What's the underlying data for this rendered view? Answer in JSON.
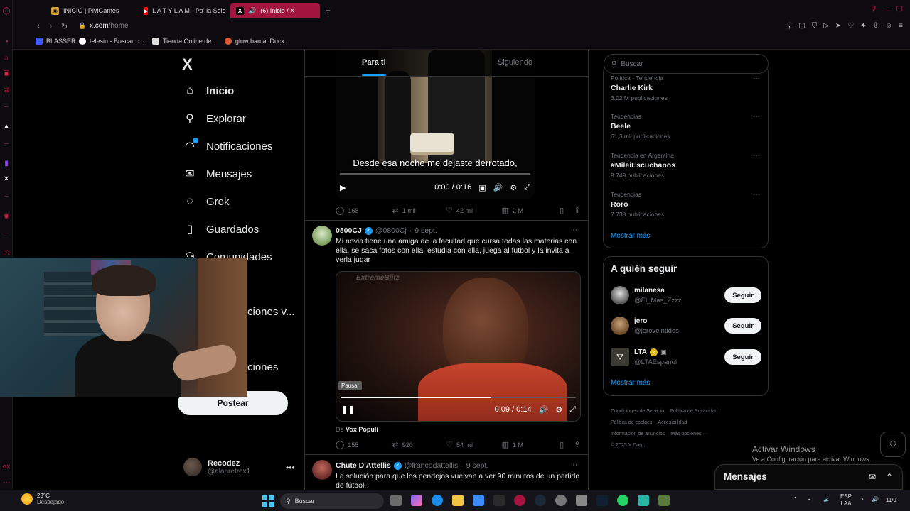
{
  "browser": {
    "tabs": [
      {
        "label": "INICIO | PiviGames",
        "active": false
      },
      {
        "label": "L A T Y L A M - Pa' la Sele",
        "active": false
      },
      {
        "label": "(6) Inicio / X",
        "active": true
      }
    ],
    "url_host": "x.com",
    "url_path": "/home",
    "bookmarks": [
      "BLASSER",
      "telesin - Buscar c...",
      "Tienda Online de...",
      "glow ban at Duck..."
    ]
  },
  "nav": {
    "logo": "X",
    "items": [
      {
        "label": "Inicio",
        "icon": "home-icon",
        "glyph": "⌂"
      },
      {
        "label": "Explorar",
        "icon": "search-icon",
        "glyph": "⚲"
      },
      {
        "label": "Notificaciones",
        "icon": "bell-icon",
        "glyph": "🔔"
      },
      {
        "label": "Mensajes",
        "icon": "mail-icon",
        "glyph": "✉"
      },
      {
        "label": "Grok",
        "icon": "grok-icon",
        "glyph": "◌"
      },
      {
        "label": "Guardados",
        "icon": "bookmark-icon",
        "glyph": "🔖"
      },
      {
        "label": "Comunidades",
        "icon": "communities-icon",
        "glyph": "👥"
      }
    ],
    "partial_items": [
      "ciones v...",
      "ciones"
    ],
    "post_label": "Postear",
    "account": {
      "name": "Recodez",
      "handle": "@alanretrox1",
      "more": "•••"
    }
  },
  "feed": {
    "tabs": [
      "Para ti",
      "Siguiendo"
    ],
    "tweet1": {
      "subtitle": "Desde esa noche me dejaste derrotado,",
      "time": "0:00 / 0:16",
      "progress": 0.0,
      "stats": {
        "replies": "168",
        "reposts": "1 mil",
        "likes": "42 mil",
        "views": "2 M"
      }
    },
    "tweet2": {
      "name": "0800CJ",
      "handle": "@0800Cj",
      "date": "9 sept.",
      "text": "Mi novia tiene una amiga de la facultad que cursa todas las materias con ella, se saca fotos con ella, estudia con ella, juega al futbol y la invita a verla jugar",
      "watermark": "ExtremeBlitz",
      "pause_tip": "Pausar",
      "time": "0:09 / 0:14",
      "progress": 0.64,
      "source_prefix": "De",
      "source_name": "Vox Populi",
      "stats": {
        "replies": "155",
        "reposts": "920",
        "likes": "54 mil",
        "views": "1 M"
      }
    },
    "tweet3": {
      "name": "Chute D'Attellis",
      "handle": "@francodattellis",
      "date": "9 sept.",
      "text": "La solución para que los pendejos vuelvan a ver 90 minutos de un partido de fútbol."
    }
  },
  "sidebar": {
    "search_placeholder": "Buscar",
    "trends": [
      {
        "category": "Política · Tendencia",
        "title": "Charlie Kirk",
        "count": "3,02 M publicaciones"
      },
      {
        "category": "Tendencias",
        "title": "Beele",
        "count": "61,3 mil publicaciones"
      },
      {
        "category": "Tendencia en Argentina",
        "title": "#MileiEscuchanos",
        "count": "9.749 publicaciones"
      },
      {
        "category": "Tendencias",
        "title": "Roro",
        "count": "7.738 publicaciones"
      }
    ],
    "show_more": "Mostrar más",
    "who_to_follow": {
      "title": "A quién seguir",
      "follow_label": "Seguir",
      "accounts": [
        {
          "name": "milanesa",
          "handle": "@El_Mas_Zzzz"
        },
        {
          "name": "jero",
          "handle": "@jeroveintidos"
        },
        {
          "name": "LTA",
          "handle": "@LTAEspanol"
        }
      ],
      "show_more": "Mostrar más"
    },
    "footer": [
      "Condiciones de Servicio",
      "Política de Privacidad",
      "Política de cookies",
      "Accesibilidad",
      "Información de anuncios",
      "Más opciones ···",
      "© 2025 X Corp."
    ]
  },
  "messages": {
    "label": "Mensajes"
  },
  "windows_activation": {
    "title": "Activar Windows",
    "subtitle": "Ve a Configuración para activar Windows."
  },
  "taskbar": {
    "temperature": "23°C",
    "condition": "Despejado",
    "search": "Buscar",
    "language": "ESP",
    "language2": "LAA",
    "date": "11/9"
  },
  "colors": {
    "accent": "#1d9bf0",
    "opera_tab": "#a3153e",
    "background": "#000000"
  }
}
